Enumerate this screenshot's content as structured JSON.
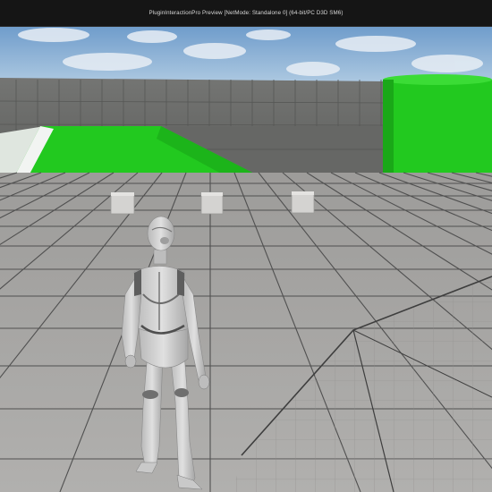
{
  "window": {
    "title": "PluginInteractionPro Preview [NetMode: Standalone 0]  (64-bit/PC D3D SM6)"
  },
  "scene": {
    "sky_color": "#8fb7dd",
    "wall_color": "#6c6d6b",
    "floor_color": "#a8a7a5",
    "green_color": "#22c91f",
    "character": "third-person-mannequin",
    "crates": [
      "crate-left",
      "crate-center",
      "crate-right"
    ]
  }
}
